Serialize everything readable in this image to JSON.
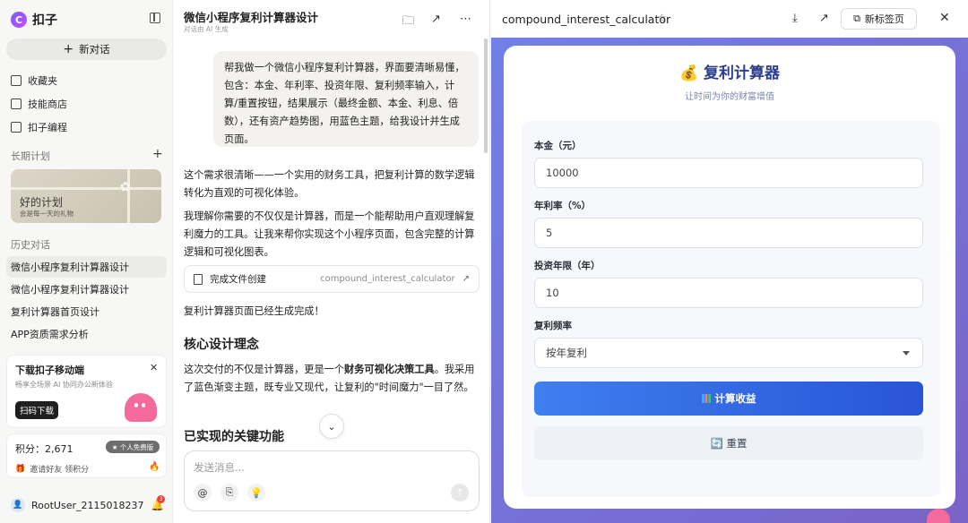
{
  "sidebar": {
    "brand_name": "扣子",
    "new_chat": "新对话",
    "nav": [
      "收藏夹",
      "技能商店",
      "扣子编程"
    ],
    "long_term_title": "长期计划",
    "plan_card": {
      "title": "好的计划",
      "subtitle": "会是每一天的礼物"
    },
    "history_title": "历史对话",
    "history": [
      "微信小程序复利计算器设计",
      "微信小程序复利计算器设计",
      "复利计算器首页设计",
      "APP资质需求分析"
    ],
    "download": {
      "title": "下载扣子移动端",
      "subtitle": "畅享全场景 AI 协同办公新体验",
      "button": "扫码下载"
    },
    "points": {
      "label": "积分：2,671",
      "badge": "个人免费版",
      "invite": "邀请好友 领积分"
    },
    "user": {
      "name": "RootUser_2115018237",
      "notifications": "3"
    }
  },
  "chat": {
    "title": "微信小程序复利计算器设计",
    "subtitle": "对话由 AI 生成",
    "user_message": "帮我做一个微信小程序复利计算器，界面要清晰易懂，包含：本金、年利率、投资年限、复利频率输入，计算/重置按钮，结果展示（最终金额、本金、利息、倍数），还有资产趋势图，用蓝色主题，给我设计并生成页面。",
    "reply_1": "这个需求很清晰——一个实用的财务工具，把复利计算的数学逻辑转化为直观的可视化体验。",
    "reply_2": "我理解你需要的不仅仅是计算器，而是一个能帮助用户直观理解复利魔力的工具。让我来帮你实现这个小程序页面，包含完整的计算逻辑和可视化图表。",
    "file_card": {
      "label": "完成文件创建",
      "name": "compound_interest_calculator"
    },
    "reply_3": "复利计算器页面已经生成完成！",
    "heading_core": "核心设计理念",
    "core_pre": "这次交付的不仅是计算器，更是一个",
    "core_bold": "财务可视化决策工具",
    "core_post": "。我采用了蓝色渐变主题，既专业又现代，让复利的\"时间魔力\"一目了然。",
    "heading_features": "已实现的关键功能",
    "input_placeholder": "发送消息..."
  },
  "preview": {
    "file_title": "compound_interest_calculator",
    "new_tab": "新标签页",
    "app": {
      "title": "💰 复利计算器",
      "subtitle": "让时间为你的财富增值",
      "principal_label": "本金（元）",
      "principal_value": "10000",
      "rate_label": "年利率（%）",
      "rate_value": "5",
      "years_label": "投资年限（年）",
      "years_value": "10",
      "freq_label": "复利频率",
      "freq_value": "按年复利",
      "calc_button": "计算收益",
      "reset_button": "🔄 重置"
    }
  }
}
